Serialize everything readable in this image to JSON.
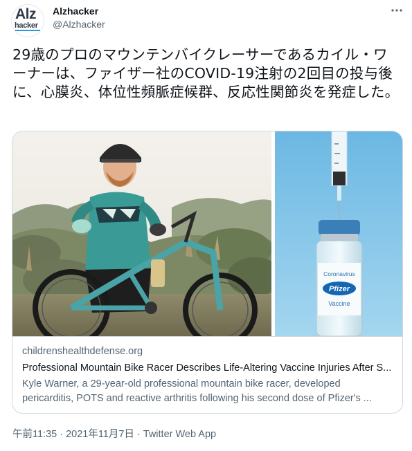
{
  "account": {
    "display_name": "Alzhacker",
    "handle": "@Alzhacker",
    "avatar_logo_top": "Alz",
    "avatar_logo_bottom": "hacker"
  },
  "more_icon": "more-horizontal-icon",
  "tweet": {
    "text": "29歳のプロのマウンテンバイクレーサーであるカイル・ワーナーは、ファイザー社のCOVID-19注射の2回目の投与後に、心膜炎、体位性頻脈症候群、反応性関節炎を発症した。"
  },
  "card": {
    "domain": "childrenshealthdefense.org",
    "title": "Professional Mountain Bike Racer Describes Life-Altering Vaccine Injuries After S...",
    "description": "Kyle Warner, a 29-year-old professional mountain bike racer, developed pericarditis, POTS and reactive arthritis following his second dose of Pfizer's ...",
    "vial_label_top": "Coronavirus",
    "vial_label_brand": "Pfizer",
    "vial_label_bottom": "Vaccine"
  },
  "meta": {
    "time": "午前11:35",
    "separator": "·",
    "date": "2021年11月7日",
    "source": "Twitter Web App"
  },
  "colors": {
    "text_primary": "#0f1419",
    "text_secondary": "#536471",
    "border": "#cfd9de",
    "vial_sky": "#7ec3e8"
  }
}
